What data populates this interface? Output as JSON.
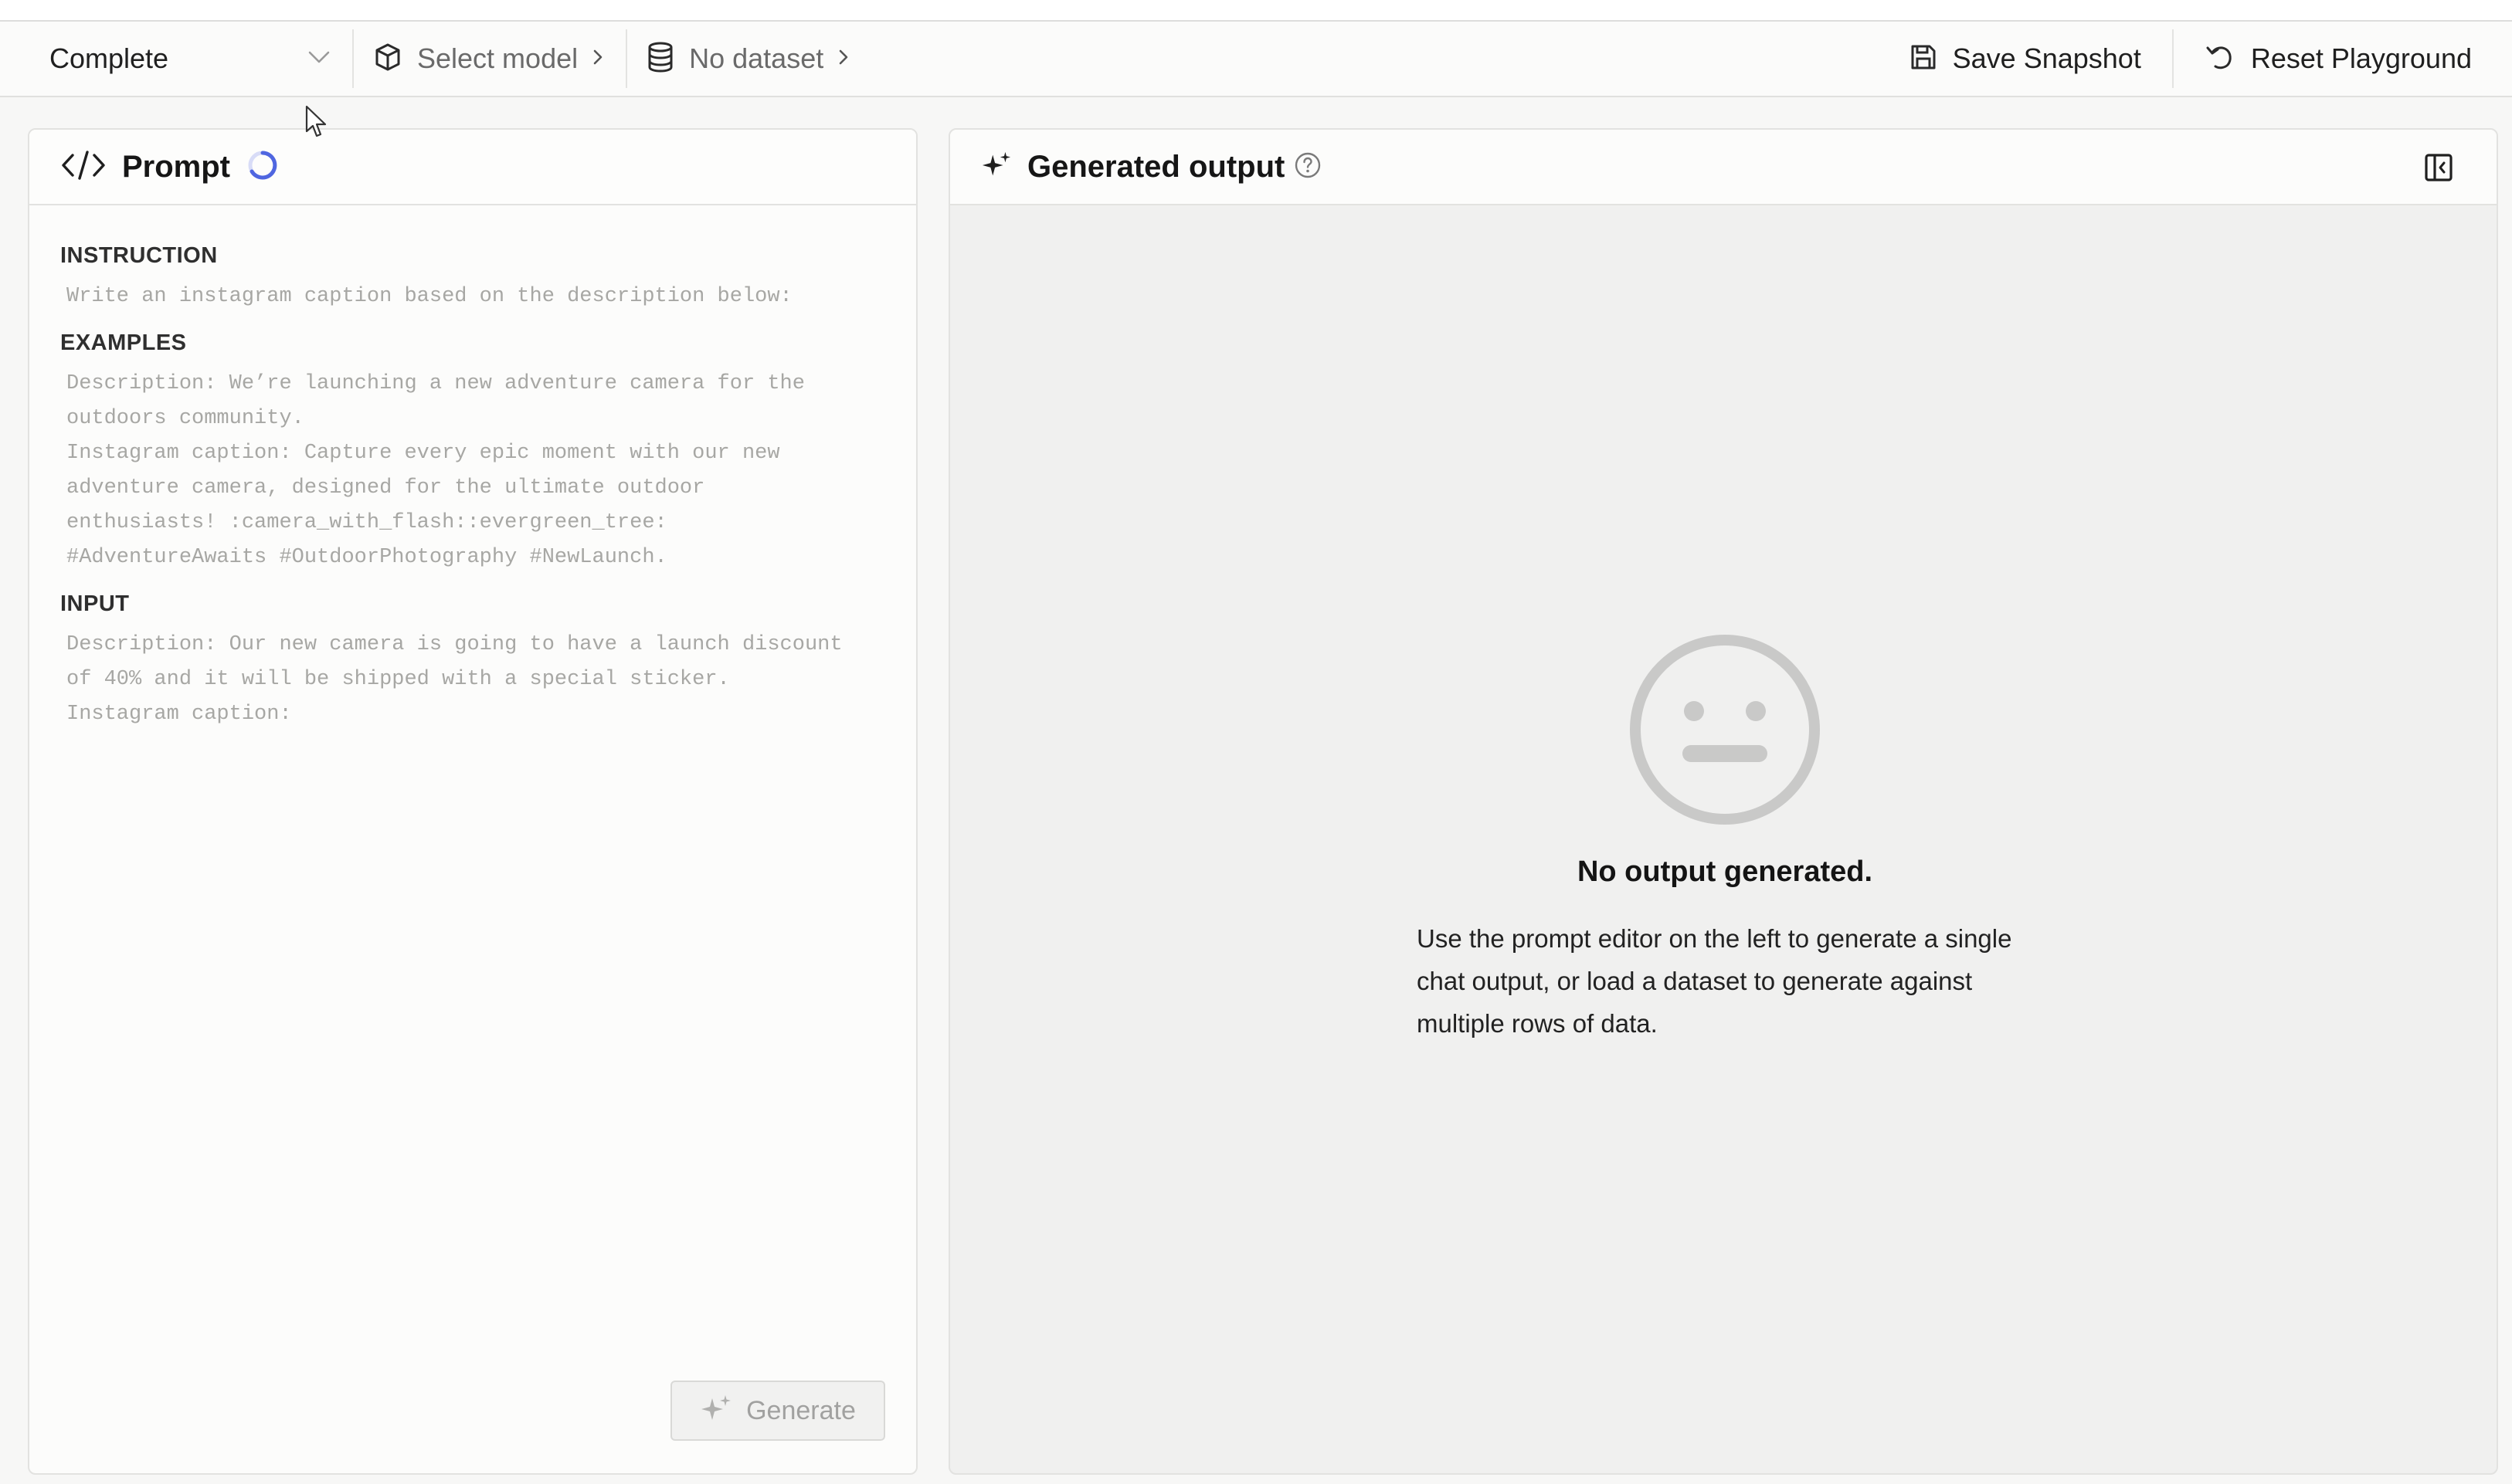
{
  "toolbar": {
    "mode_select": {
      "value": "Complete"
    },
    "model_crumb": {
      "label": "Select model"
    },
    "dataset_crumb": {
      "label": "No dataset"
    },
    "save_snapshot_label": "Save Snapshot",
    "reset_playground_label": "Reset Playground"
  },
  "prompt_panel": {
    "title": "Prompt",
    "loading": true,
    "sections": {
      "instruction": {
        "label": "INSTRUCTION",
        "text": "Write an instagram caption based on the description below:"
      },
      "examples": {
        "label": "EXAMPLES",
        "text": "Description: We’re launching a new adventure camera for the\noutdoors community.\nInstagram caption: Capture every epic moment with our new\nadventure camera, designed for the ultimate outdoor\nenthusiasts! :camera_with_flash::evergreen_tree:\n#AdventureAwaits #OutdoorPhotography #NewLaunch."
      },
      "input": {
        "label": "INPUT",
        "text": "Description: Our new camera is going to have a launch discount\nof 40% and it will be shipped with a special sticker.\nInstagram caption:"
      }
    },
    "generate_label": "Generate"
  },
  "output_panel": {
    "title": "Generated output",
    "empty_state": {
      "title": "No output generated.",
      "description": "Use the prompt editor on the left to generate a single chat output, or load a dataset to generate against multiple rows of data."
    }
  },
  "colors": {
    "accent_spinner": "#4f66e0",
    "muted_text": "#a7a7a4",
    "panel_border": "#e2e2e0",
    "empty_icon": "#c9c9c8"
  },
  "icons": {
    "chevron": "chevron-down-icon",
    "model": "cube-icon",
    "dataset": "database-icon",
    "save": "floppy-disk-icon",
    "reset": "undo-icon",
    "prompt": "code-icon",
    "output": "sparkles-icon",
    "help": "question-circle-icon",
    "collapse": "sidebar-collapse-icon",
    "empty": "neutral-face-icon"
  }
}
